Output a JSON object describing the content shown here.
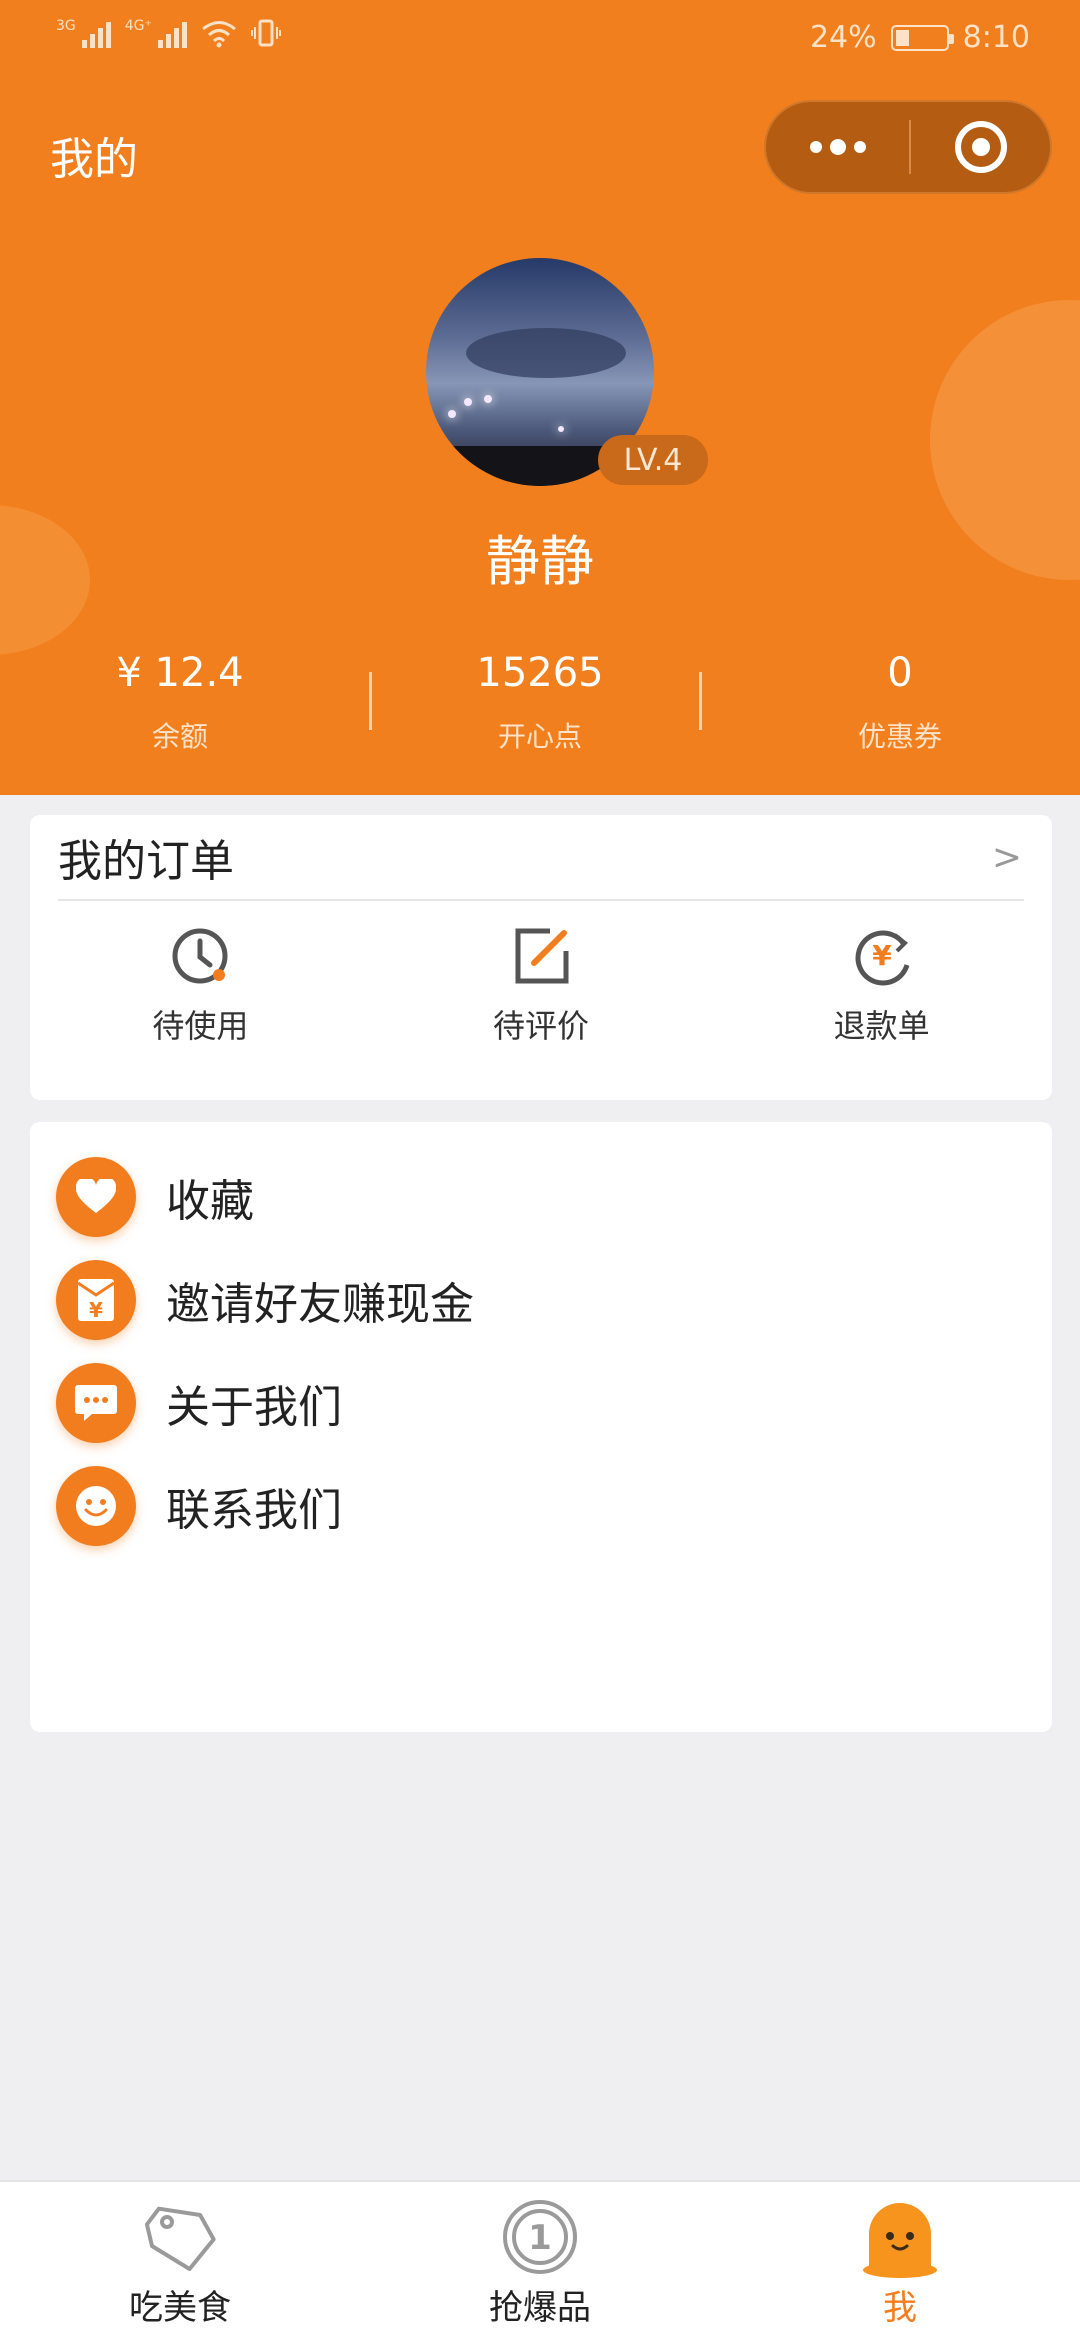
{
  "status_bar": {
    "net1": "3G",
    "net2": "4G⁺",
    "battery": "24%",
    "time": "8:10"
  },
  "header": {
    "title": "我的"
  },
  "profile": {
    "name": "静静",
    "level": "LV.4"
  },
  "stats": [
    {
      "value": "¥ 12.4",
      "label": "余额"
    },
    {
      "value": "15265",
      "label": "开心点"
    },
    {
      "value": "0",
      "label": "优惠券"
    }
  ],
  "orders": {
    "title": "我的订单",
    "arrow": ">",
    "items": [
      {
        "label": "待使用",
        "icon": "clock-icon"
      },
      {
        "label": "待评价",
        "icon": "edit-icon"
      },
      {
        "label": "退款单",
        "icon": "refund-yen-icon"
      }
    ]
  },
  "menu": [
    {
      "label": "收藏",
      "icon": "heart-icon"
    },
    {
      "label": "邀请好友赚现金",
      "icon": "red-envelope-yen-icon"
    },
    {
      "label": "关于我们",
      "icon": "chat-bubble-icon"
    },
    {
      "label": "联系我们",
      "icon": "smiley-icon"
    }
  ],
  "tabs": [
    {
      "label": "吃美食",
      "icon": "tag-icon",
      "active": false
    },
    {
      "label": "抢爆品",
      "icon": "coin-one-icon",
      "active": false
    },
    {
      "label": "我",
      "icon": "mascot-face-icon",
      "active": true
    }
  ],
  "colors": {
    "brand": "#f27f1e",
    "background": "#efeff2"
  }
}
